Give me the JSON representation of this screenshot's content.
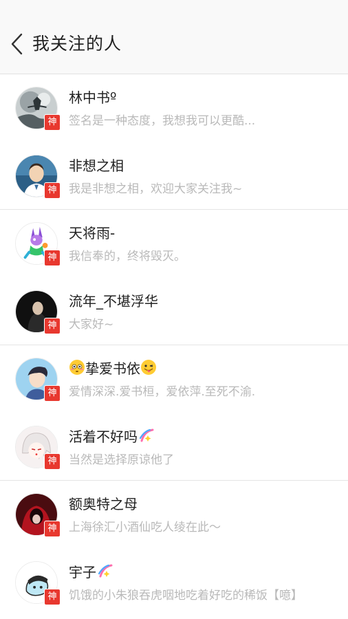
{
  "header": {
    "back_icon": "chevron-left-icon",
    "title": "我关注的人"
  },
  "colors": {
    "badge": "#e8382f",
    "name": "#222222",
    "signature": "#b9b9b9",
    "divider": "#e4e4e4"
  },
  "badge_label": "神",
  "users": [
    {
      "name": "林中书º",
      "signature": "签名是一种态度，我想我可以更酷..."
    },
    {
      "name": "非想之相",
      "signature": "我是非想之相，欢迎大家关注我~"
    },
    {
      "name": "天将雨-",
      "signature": "我信奉的，终将毁灭。"
    },
    {
      "name": "流年_不堪浮华",
      "signature": "大家好~"
    },
    {
      "name": "挚爱书依",
      "name_prefix_emoji": "flushed-face",
      "name_suffix_emoji": "tongue-wink-face",
      "signature": "爱情深深.爱书桓，爱依萍.至死不渝."
    },
    {
      "name": "活着不好吗",
      "name_suffix_emoji": "sparkle-emoji",
      "signature": "当然是选择原谅他了"
    },
    {
      "name": "额奥特之母",
      "signature": "上海徐汇小酒仙吃人绫在此～"
    },
    {
      "name": "宇子",
      "name_suffix_emoji": "sparkle-emoji",
      "signature": "饥饿的小朱狼吞虎咽地吃着好吃的稀饭【噫】"
    }
  ]
}
